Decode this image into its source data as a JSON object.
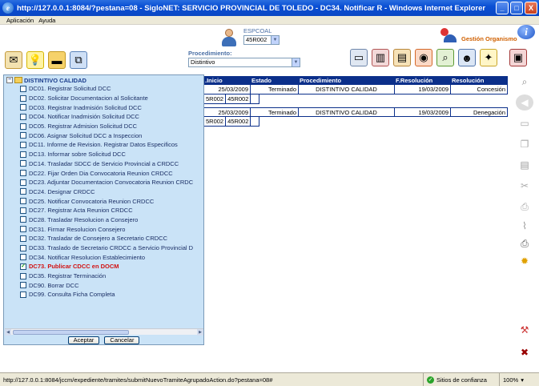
{
  "window": {
    "title": "http://127.0.0.1:8084/?pestana=08 - SigloNET: SERVICIO PROVINCIAL DE TOLEDO - DC34. Notificar R - Windows Internet Explorer",
    "minimize": "_",
    "maximize": "□",
    "close": "X"
  },
  "menu": [
    "Aplicación",
    "Ayuda"
  ],
  "header": {
    "espcoal_label": "ESPCOAL",
    "espcoal_value": "45R002",
    "gestion_label": "Gestión Organismo",
    "procedimiento_label": "Procedimiento:",
    "procedimiento_value": "Distintivo"
  },
  "grid": {
    "columns": [
      ".Inicio",
      "Estado",
      "Procedimiento",
      "F.Resolución",
      "Resolución"
    ],
    "rows": [
      {
        "inicio": "25/03/2009",
        "estado": "Terminado",
        "procedimiento": "DISTINTIVO CALIDAD",
        "f_resolucion": "19/03/2009",
        "resolucion": "Concesión",
        "sub": [
          "5R002",
          "45R002"
        ]
      },
      {
        "inicio": "25/03/2009",
        "estado": "Terminado",
        "procedimiento": "DISTINTIVO CALIDAD",
        "f_resolucion": "19/03/2009",
        "resolucion": "Denegación",
        "sub": [
          "5R002",
          "45R002"
        ]
      }
    ]
  },
  "tree": {
    "root": "DISTINTIVO CALIDAD",
    "items": [
      {
        "label": "DC01. Registrar Solicitud DCC",
        "checked": false
      },
      {
        "label": "DC02. Solicitar Documentacion al Solicitante",
        "checked": false
      },
      {
        "label": "DC03. Registrar Inadmisión Solicitud DCC",
        "checked": false
      },
      {
        "label": "DC04. Notificar Inadmisión Solicitud DCC",
        "checked": false
      },
      {
        "label": "DC05. Registrar Admision Solicitud DCC",
        "checked": false
      },
      {
        "label": "DC06. Asignar Solicitud DCC a Inspeccion",
        "checked": false
      },
      {
        "label": "DC11. Informe de Revision. Registrar Datos Especificos",
        "checked": false
      },
      {
        "label": "DC13. Informar sobre Solicitud DCC",
        "checked": false
      },
      {
        "label": "DC14. Trasladar SDCC de Servicio Provincial a CRDCC",
        "checked": false
      },
      {
        "label": "DC22. Fijar Orden Dia Convocatoria Reunion CRDCC",
        "checked": false
      },
      {
        "label": "DC23. Adjuntar Documentacion Convocatoria Reunion CRDC",
        "checked": false
      },
      {
        "label": "DC24. Designar CRDCC",
        "checked": false
      },
      {
        "label": "DC25. Notificar Convocatoria Reunion CRDCC",
        "checked": false
      },
      {
        "label": "DC27. Registrar Acta Reunion CRDCC",
        "checked": false
      },
      {
        "label": "DC28. Trasladar Resolucion a Consejero",
        "checked": false
      },
      {
        "label": "DC31. Firmar Resolucion Consejero",
        "checked": false
      },
      {
        "label": "DC32. Trasladar de Consejero a Secretario CRDCC",
        "checked": false
      },
      {
        "label": "DC33. Traslado de Secretario CRDCC a Servicio Provincial D",
        "checked": false
      },
      {
        "label": "DC34. Notificar Resolucion Establecimiento",
        "checked": false
      },
      {
        "label": "DC73. Publicar CDCC en DOCM",
        "checked": true
      },
      {
        "label": "DC35. Registrar Terminación",
        "checked": false
      },
      {
        "label": "DC90. Borrar DCC",
        "checked": false
      },
      {
        "label": "DC99. Consulta Ficha Completa",
        "checked": false
      }
    ],
    "accept_label": "Aceptar",
    "cancel_label": "Cancelar"
  },
  "status": {
    "url": "http://127.0.0.1:8084/jccm/expediente/tramites/submitNuevoTramiteAgrupadoAction.do?pestana=08#",
    "zone": "Sitios de confianza",
    "zoom": "100%"
  },
  "colors": {
    "titlebar": "#0a4fd4",
    "grid_header": "#0b2f8a",
    "tree_bg": "#cae3f7",
    "checked_item": "#d21111"
  }
}
